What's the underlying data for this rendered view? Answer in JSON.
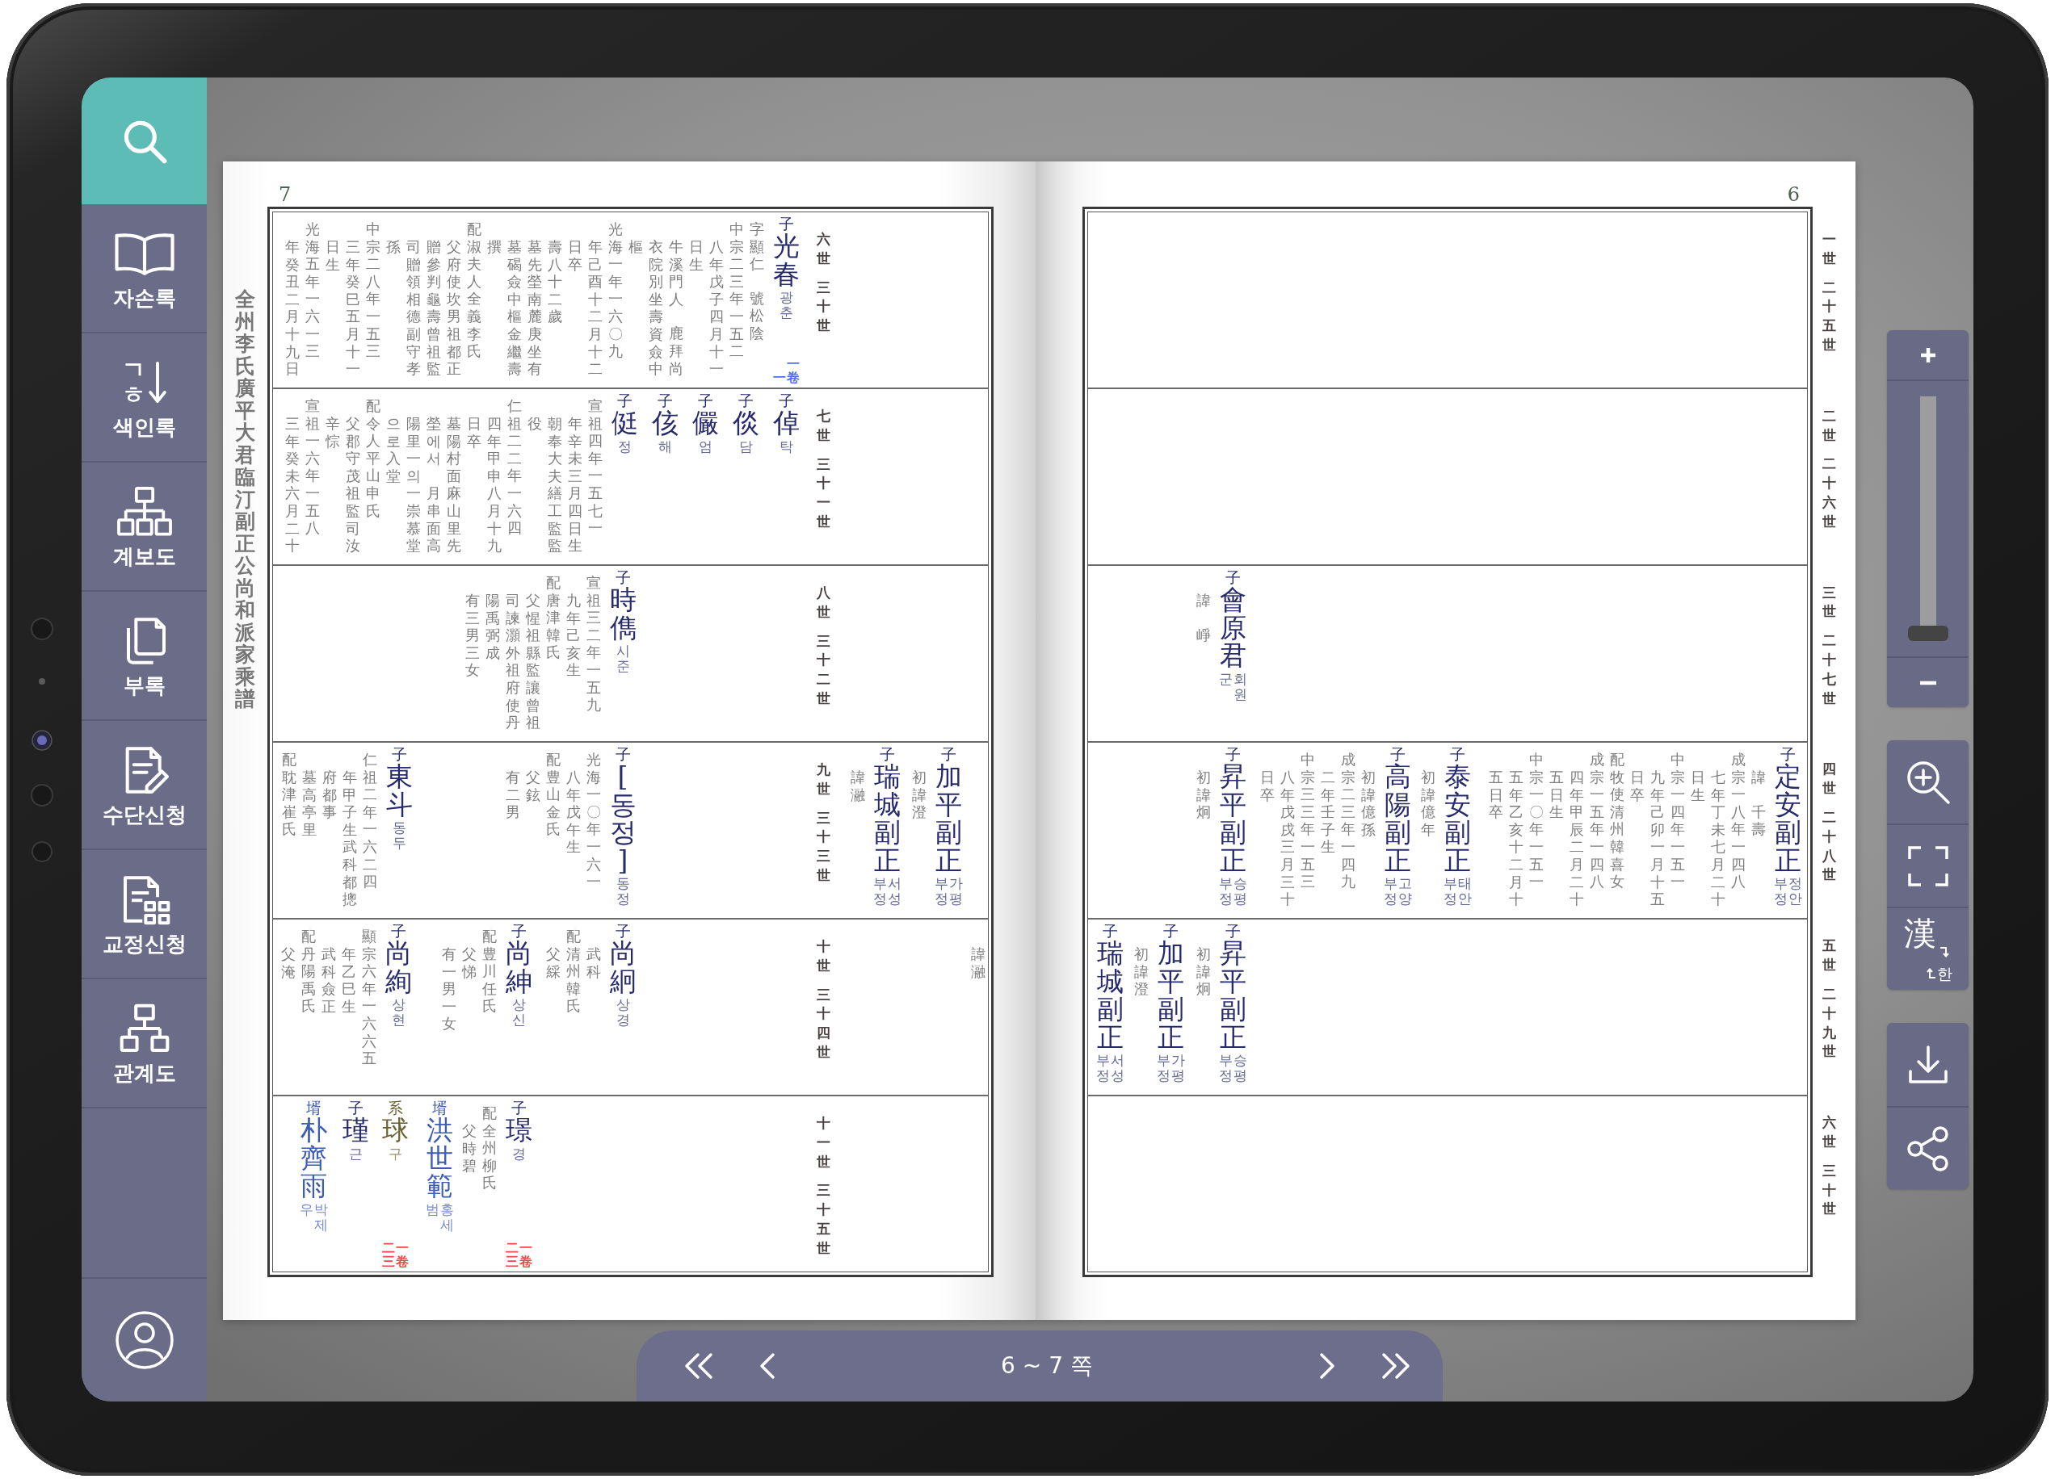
{
  "sidebar": {
    "items": [
      {
        "label": "자손록",
        "selected": false
      },
      {
        "label": "색인록",
        "glyph": "ㄱㅎ",
        "selected": false
      },
      {
        "label": "계보도",
        "selected": false
      },
      {
        "label": "부록",
        "selected": false
      },
      {
        "label": "수단신청",
        "selected": false
      },
      {
        "label": "교정신청",
        "selected": false
      },
      {
        "label": "관계도",
        "selected": false
      }
    ]
  },
  "book": {
    "pages": [
      {
        "kind": "left",
        "number": "7",
        "title": "全州李氏廣平大君臨汀副正公尚和派家乘譜",
        "rows": [
          {
            "generation": [
              "六世",
              "三十世"
            ],
            "entries": [
              {
                "relation": "子",
                "name": "光春",
                "reading": [
                  "광춘"
                ],
                "color": "#272b6c",
                "ref": {
                  "volume": "一卷",
                  "page": "一",
                  "color": "#4f6ff7"
                },
                "notes": [
                  {
                    "text": "年癸丑二月十九日",
                    "kind": "rest"
                  },
                  {
                    "text": "光海五年一六一三",
                    "kind": "first"
                  },
                  {
                    "text": "日生",
                    "kind": "rest"
                  },
                  {
                    "text": "三年癸巳五月十一",
                    "kind": "rest"
                  },
                  {
                    "text": "中宗二八年一五三",
                    "kind": "first"
                  },
                  {
                    "text": "孫",
                    "kind": "rest"
                  },
                  {
                    "text": "司贈領相德副守孝",
                    "kind": "rest"
                  },
                  {
                    "text": "贈參判龜壽曾祖監",
                    "kind": "rest"
                  },
                  {
                    "text": "父府使坎男祖都正",
                    "kind": "rest"
                  },
                  {
                    "text": "配淑夫人全義李氏",
                    "kind": "first"
                  },
                  {
                    "text": "撰",
                    "kind": "rest"
                  },
                  {
                    "text": "墓碣僉中樞金繼壽",
                    "kind": "rest"
                  },
                  {
                    "text": "墓先塋南麓庚坐有",
                    "kind": "rest"
                  },
                  {
                    "text": "壽八十二歲",
                    "kind": "rest"
                  },
                  {
                    "text": "日卒",
                    "kind": "rest"
                  },
                  {
                    "text": "年己酉十二月十二",
                    "kind": "rest"
                  },
                  {
                    "text": "光海一年一六〇九",
                    "kind": "first"
                  },
                  {
                    "text": "樞",
                    "kind": "rest"
                  },
                  {
                    "text": "衣院別坐壽資僉中",
                    "kind": "rest"
                  },
                  {
                    "parts": [
                      "牛溪門人",
                      "鹿拜尚"
                    ],
                    "kind": "rest"
                  },
                  {
                    "text": "日生",
                    "kind": "rest"
                  },
                  {
                    "text": "八年戊子四月十一",
                    "kind": "rest"
                  },
                  {
                    "text": "中宗二三年一五二",
                    "kind": "first"
                  },
                  {
                    "parts": [
                      "字顯仁",
                      "號松陰"
                    ],
                    "kind": "first"
                  }
                ]
              }
            ]
          },
          {
            "generation": [
              "七世",
              "三十一世"
            ],
            "entries": [
              {
                "relation": "子",
                "name": "侹",
                "reading": [
                  "정"
                ],
                "color": "#272b6c",
                "notes": [
                  {
                    "text": "三年癸未六月二十",
                    "kind": "rest"
                  },
                  {
                    "text": "宣祖一六年一五八",
                    "kind": "first"
                  },
                  {
                    "text": "辛悰",
                    "kind": "rest"
                  },
                  {
                    "text": "父郡守茂祖監司汝",
                    "kind": "rest"
                  },
                  {
                    "text": "配令人平山申氏",
                    "kind": "first"
                  },
                  {
                    "text": "으로入堂",
                    "kind": "rest"
                  },
                  {
                    "text": "陽里一의一崇慕堂",
                    "kind": "rest"
                  },
                  {
                    "text": "塋에서 月串面高",
                    "kind": "rest"
                  },
                  {
                    "text": "墓陽村面麻山里先",
                    "kind": "rest"
                  },
                  {
                    "text": "日卒",
                    "kind": "rest"
                  },
                  {
                    "text": "四年甲申八月十九",
                    "kind": "rest"
                  },
                  {
                    "text": "仁祖二二年一六四",
                    "kind": "first"
                  },
                  {
                    "text": "役",
                    "kind": "rest"
                  },
                  {
                    "text": "朝奉大夫繕工監監",
                    "kind": "rest"
                  },
                  {
                    "text": "年辛未三月四日生",
                    "kind": "rest"
                  },
                  {
                    "text": "宣祖四年一五七一",
                    "kind": "first"
                  }
                ]
              },
              {
                "relation": "子",
                "name": "侅",
                "reading": [
                  "해"
                ],
                "color": "#272b6c"
              },
              {
                "relation": "子",
                "name": "儼",
                "reading": [
                  "엄"
                ],
                "color": "#272b6c"
              },
              {
                "relation": "子",
                "name": "倓",
                "reading": [
                  "담"
                ],
                "color": "#272b6c"
              },
              {
                "relation": "子",
                "name": "倬",
                "reading": [
                  "탁"
                ],
                "color": "#272b6c"
              }
            ]
          },
          {
            "generation": [
              "八世",
              "三十二世"
            ],
            "entries": [
              {
                "relation": "子",
                "name": "時儁",
                "reading": [
                  "시준"
                ],
                "color": "#272b6c",
                "notes": [
                  {
                    "text": "有三男三女",
                    "kind": "rest"
                  },
                  {
                    "text": "陽禹弼成",
                    "kind": "rest"
                  },
                  {
                    "text": "司諫灝外祖府使丹",
                    "kind": "rest"
                  },
                  {
                    "text": "父惺祖縣監讓曾祖",
                    "kind": "rest"
                  },
                  {
                    "text": "配唐津韓氏",
                    "kind": "first"
                  },
                  {
                    "text": "九年己亥生",
                    "kind": "rest"
                  },
                  {
                    "text": "宣祖三二年一五九",
                    "kind": "first"
                  }
                ]
              }
            ]
          },
          {
            "generation": [
              "九世",
              "三十三世"
            ],
            "carried": [
              {
                "relation": "子",
                "name": "瑞城副正",
                "reading": [
                  "부정",
                  "서성"
                ],
                "color": "#272b6c",
                "notes": [
                  {
                    "text": "諱瀜",
                    "kind": "rest"
                  }
                ]
              },
              {
                "relation": "子",
                "name": "加平副正",
                "reading": [
                  "부정",
                  "가평"
                ],
                "color": "#272b6c",
                "notes": [
                  {
                    "text": "初諱澄",
                    "kind": "rest"
                  }
                ]
              }
            ],
            "entries": [
              {
                "relation": "子",
                "name": "東斗",
                "reading": [
                  "동두"
                ],
                "color": "#272b6c",
                "notes": [
                  {
                    "text": "配耽津崔氏",
                    "kind": "first"
                  },
                  {
                    "text": "墓高亭里",
                    "kind": "rest"
                  },
                  {
                    "text": "府都事",
                    "kind": "rest"
                  },
                  {
                    "text": "年甲子生武科都摠",
                    "kind": "rest"
                  },
                  {
                    "text": "仁祖二年一六二四",
                    "kind": "first"
                  }
                ]
              },
              {
                "relation": "子",
                "name": "[동정]",
                "reading": [
                  "동정"
                ],
                "color": "#272b6c",
                "notes": [
                  {
                    "text": "有二男",
                    "kind": "rest"
                  },
                  {
                    "text": "父鉉",
                    "kind": "rest"
                  },
                  {
                    "text": "配豊山金氏",
                    "kind": "first"
                  },
                  {
                    "text": "八年戊午生",
                    "kind": "rest"
                  },
                  {
                    "text": "光海一〇年一六一",
                    "kind": "first"
                  }
                ]
              }
            ]
          },
          {
            "generation": [
              "十世",
              "三十四世"
            ],
            "carried": [
              {
                "notes": [
                  {
                    "text": "諱瀜",
                    "kind": "rest"
                  }
                ]
              }
            ],
            "entries": [
              {
                "relation": "子",
                "name": "尚絢",
                "reading": [
                  "상현"
                ],
                "color": "#272b6c",
                "notes": [
                  {
                    "text": "父淹",
                    "kind": "rest"
                  },
                  {
                    "text": "配丹陽禹氏",
                    "kind": "first"
                  },
                  {
                    "text": "武科僉正",
                    "kind": "rest"
                  },
                  {
                    "text": "年乙巳生",
                    "kind": "rest"
                  },
                  {
                    "text": "顯宗六年一六六五",
                    "kind": "first"
                  }
                ]
              },
              {
                "relation": "子",
                "name": "尚紳",
                "reading": [
                  "상신"
                ],
                "color": "#272b6c",
                "notes": [
                  {
                    "text": "有一男一女",
                    "kind": "rest"
                  },
                  {
                    "text": "父悌",
                    "kind": "rest"
                  },
                  {
                    "text": "配豊川任氏",
                    "kind": "first"
                  }
                ]
              },
              {
                "relation": "子",
                "name": "尚絅",
                "reading": [
                  "상경"
                ],
                "color": "#272b6c",
                "notes": [
                  {
                    "text": "父綵",
                    "kind": "rest"
                  },
                  {
                    "text": "配清州韓氏",
                    "kind": "first"
                  },
                  {
                    "text": "武科",
                    "kind": "rest"
                  }
                ]
              }
            ]
          },
          {
            "generation": [
              "十一世",
              "三十五世"
            ],
            "entries": [
              {
                "relation": "壻",
                "name": "朴齊雨",
                "reading": [
                  "우",
                  "박제"
                ],
                "color": "#3e5cb4"
              },
              {
                "relation": "子",
                "name": "瑾",
                "reading": [
                  "근"
                ],
                "color": "#272b6c"
              },
              {
                "relation": "系",
                "name": "球",
                "reading": [
                  "구"
                ],
                "color": "#6a6232",
                "ref": {
                  "volume": "一卷",
                  "page": "二三",
                  "color": "#f0494a"
                }
              },
              {
                "relation": "壻",
                "name": "洪世範",
                "reading": [
                  "범",
                  "홍세"
                ],
                "color": "#3e5cb4"
              },
              {
                "relation": "子",
                "name": "璟",
                "reading": [
                  "경"
                ],
                "color": "#272b6c",
                "ref": {
                  "volume": "一卷",
                  "page": "二三",
                  "color": "#f0494a"
                },
                "notes": [
                  {
                    "text": "父時碧",
                    "kind": "rest"
                  },
                  {
                    "text": "配全州柳氏",
                    "kind": "first"
                  }
                ]
              }
            ]
          }
        ]
      },
      {
        "kind": "right",
        "number": "6",
        "rows": [
          {
            "generation": [
              "一世",
              "二十五世"
            ]
          },
          {
            "generation": [
              "二世",
              "二十六世"
            ]
          },
          {
            "generation": [
              "三世",
              "二十七世"
            ],
            "entries": [
              {
                "relation": "子",
                "name": "會原君",
                "reading": [
                  "군",
                  "회원"
                ],
                "color": "#272b6c",
                "notes": [
                  {
                    "parts": [
                      "諱",
                      "崢"
                    ],
                    "kind": "rest"
                  }
                ]
              }
            ]
          },
          {
            "generation": [
              "四世",
              "二十八世"
            ],
            "entries": [
              {
                "relation": "子",
                "name": "昇平副正",
                "reading": [
                  "부정",
                  "승평"
                ],
                "color": "#272b6c",
                "notes": [
                  {
                    "text": "初諱炯",
                    "kind": "rest"
                  }
                ]
              },
              {
                "relation": "子",
                "name": "高陽副正",
                "reading": [
                  "부정",
                  "고양"
                ],
                "color": "#272b6c",
                "notes": [
                  {
                    "text": "日卒",
                    "kind": "rest"
                  },
                  {
                    "text": "八年戊戌三月三十",
                    "kind": "rest"
                  },
                  {
                    "text": "中宗三三年一五三",
                    "kind": "first"
                  },
                  {
                    "text": "二年壬子生",
                    "kind": "rest"
                  },
                  {
                    "text": "成宗二三年一四九",
                    "kind": "first"
                  },
                  {
                    "text": "初諱億孫",
                    "kind": "rest"
                  }
                ]
              },
              {
                "relation": "子",
                "name": "泰安副正",
                "reading": [
                  "부정",
                  "태안"
                ],
                "color": "#272b6c",
                "notes": [
                  {
                    "text": "初諱億年",
                    "kind": "rest"
                  }
                ]
              },
              {
                "relation": "子",
                "name": "定安副正",
                "reading": [
                  "부정",
                  "정안"
                ],
                "color": "#272b6c",
                "notes": [
                  {
                    "text": "五日卒",
                    "kind": "rest"
                  },
                  {
                    "text": "五年乙亥十二月十",
                    "kind": "rest"
                  },
                  {
                    "text": "中宗一〇年一五一",
                    "kind": "first"
                  },
                  {
                    "text": "五日生",
                    "kind": "rest"
                  },
                  {
                    "text": "四年甲辰二月二十",
                    "kind": "rest"
                  },
                  {
                    "text": "成宗一五年一四八",
                    "kind": "first"
                  },
                  {
                    "text": "配牧使清州韓喜女",
                    "kind": "first"
                  },
                  {
                    "text": "日卒",
                    "kind": "rest"
                  },
                  {
                    "text": "九年己卯一月十五",
                    "kind": "rest"
                  },
                  {
                    "text": "中宗一四年一五一",
                    "kind": "first"
                  },
                  {
                    "text": "日生",
                    "kind": "rest"
                  },
                  {
                    "text": "七年丁未七月二十",
                    "kind": "rest"
                  },
                  {
                    "text": "成宗一八年一四八",
                    "kind": "first"
                  },
                  {
                    "parts": [
                      "諱",
                      "千壽"
                    ],
                    "kind": "rest"
                  }
                ]
              }
            ]
          },
          {
            "generation": [
              "五世",
              "二十九世"
            ],
            "entries": [
              {
                "relation": "子",
                "name": "瑞城副正",
                "reading": [
                  "부정",
                  "서성"
                ],
                "color": "#272b6c"
              },
              {
                "relation": "子",
                "name": "加平副正",
                "reading": [
                  "부정",
                  "가평"
                ],
                "color": "#272b6c",
                "notes": [
                  {
                    "text": "初諱澄",
                    "kind": "rest"
                  }
                ]
              },
              {
                "relation": "子",
                "name": "昇平副正",
                "reading": [
                  "부정",
                  "승평"
                ],
                "color": "#272b6c",
                "notes": [
                  {
                    "text": "初諱炯",
                    "kind": "rest"
                  }
                ]
              }
            ]
          },
          {
            "generation": [
              "六世",
              "三十世"
            ]
          }
        ]
      }
    ]
  },
  "toolbar": {
    "zoom": {
      "level": 0
    },
    "script_toggle": {
      "hanja": "漢",
      "hangul": "한"
    }
  },
  "navigation": {
    "page_range": "6 ~ 7 쪽"
  }
}
